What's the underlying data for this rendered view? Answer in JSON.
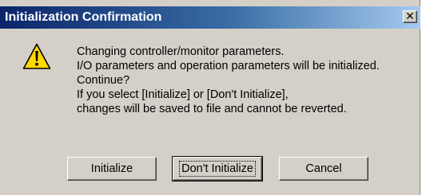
{
  "dialog": {
    "title": "Initialization Confirmation",
    "close_symbol": "✕",
    "icon": "warning-icon",
    "message_lines": [
      "Changing controller/monitor parameters.",
      "I/O parameters and operation parameters will be initialized.",
      "Continue?",
      "If you select [Initialize] or [Don't Initialize],",
      "changes will be saved to file and cannot be reverted."
    ],
    "buttons": {
      "initialize": "Initialize",
      "dont_initialize": "Don't Initialize",
      "cancel": "Cancel"
    }
  },
  "colors": {
    "titlebar_start": "#0a246a",
    "titlebar_end": "#a6caf0",
    "face": "#d4d0c8",
    "warning_fill": "#ffd800"
  }
}
